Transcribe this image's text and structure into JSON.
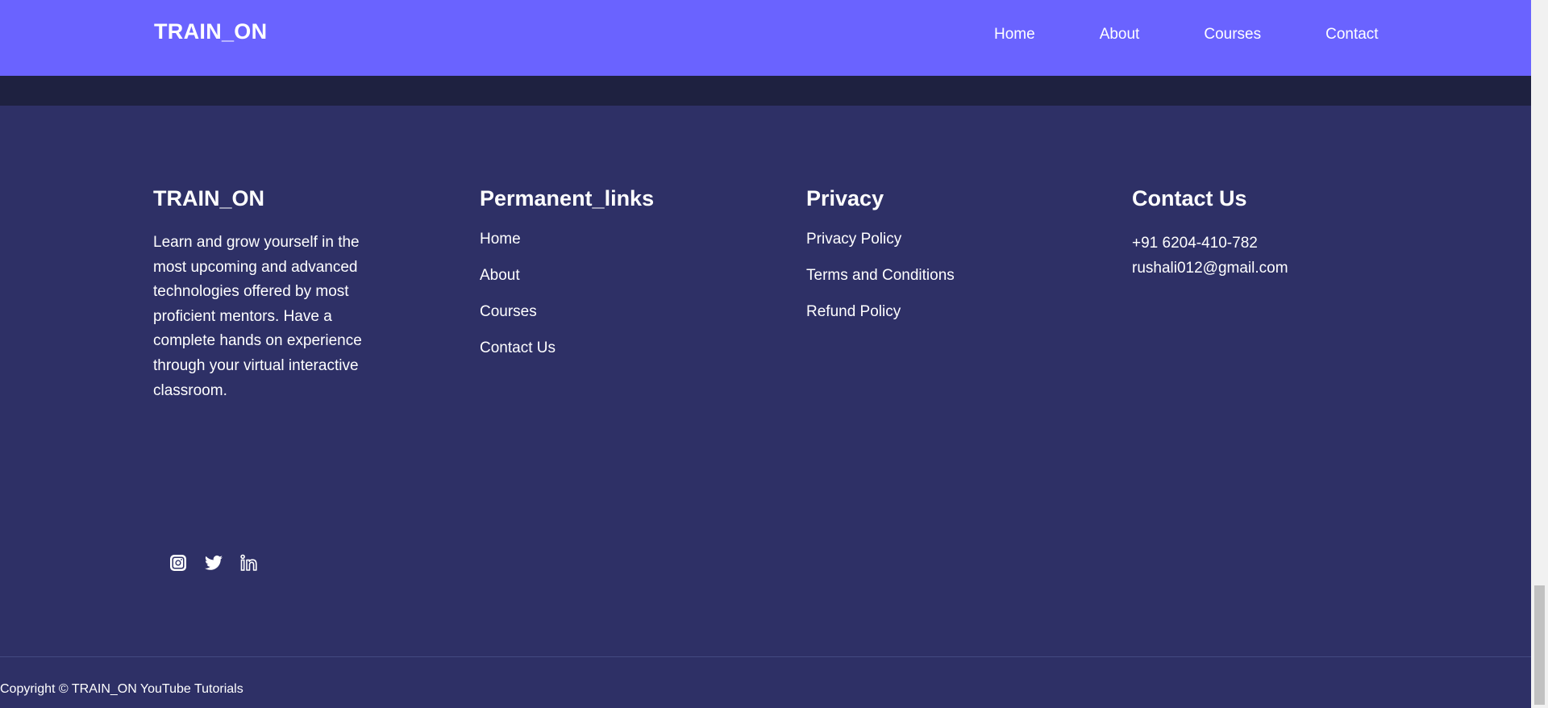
{
  "navbar": {
    "brand": "TRAIN_ON",
    "links": [
      "Home",
      "About",
      "Courses",
      "Contact"
    ]
  },
  "footer": {
    "about": {
      "heading": "TRAIN_ON",
      "text": "Learn and grow yourself in the most upcoming and advanced technologies offered by most proficient mentors. Have a complete hands on experience through your virtual interactive classroom."
    },
    "permanent_links": {
      "heading": "Permanent_links",
      "items": [
        "Home",
        "About",
        "Courses",
        "Contact Us"
      ]
    },
    "privacy": {
      "heading": "Privacy",
      "items": [
        "Privacy Policy",
        "Terms and Conditions",
        "Refund Policy"
      ]
    },
    "contact": {
      "heading": "Contact Us",
      "phone": "+91 6204-410-782",
      "email": "rushali012@gmail.com"
    },
    "social_icons": [
      "instagram-icon",
      "twitter-icon",
      "linkedin-icon"
    ],
    "copyright": "Copyright © TRAIN_ON YouTube Tutorials"
  },
  "colors": {
    "navbar": "#6a63ff",
    "footer_bg": "#2e3066",
    "band": "#1e2140",
    "text": "#ffffff"
  }
}
